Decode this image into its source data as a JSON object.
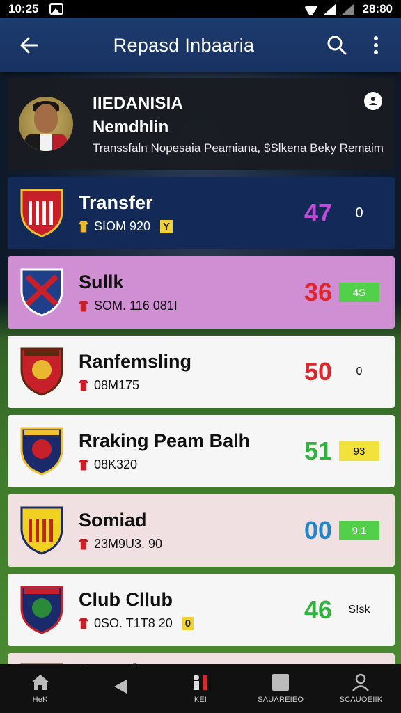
{
  "status_bar": {
    "time": "10:25",
    "clock_right": "28:80"
  },
  "app_bar": {
    "title": "Repasd Inbaaria"
  },
  "profile": {
    "name_line1": "IIEDANISIA",
    "name_line2": "Nemdhlin",
    "description": "Transsfaln Nopesaia Peamiana, $Slkena Beky Remaim"
  },
  "rows": [
    {
      "club": "Transfer",
      "sub": "SIOM 920",
      "tag": "Y",
      "score": "47",
      "score_color": "#c04ad8",
      "chip": "0",
      "chip_style": "plain-light",
      "style": "transfer",
      "crest": "red-white"
    },
    {
      "club": "Sullk",
      "sub": "SOM. 116 081I",
      "tag": "",
      "score": "36",
      "score_color": "#e0242a",
      "chip": "4S",
      "chip_style": "green",
      "style": "pink",
      "crest": "blue-x"
    },
    {
      "club": "Ranfemsling",
      "sub": "08M175",
      "tag": "",
      "score": "50",
      "score_color": "#e0242a",
      "chip": "0",
      "chip_style": "plain",
      "style": "white",
      "crest": "red-gold"
    },
    {
      "club": "Rraking Peam Balh",
      "sub": "08K320",
      "tag": "",
      "score": "51",
      "score_color": "#2fb33a",
      "chip": "93",
      "chip_style": "yellow",
      "style": "white",
      "crest": "navy-red"
    },
    {
      "club": "Somiad",
      "sub": "23M9U3. 90",
      "tag": "",
      "score": "00",
      "score_color": "#1e86c8",
      "chip": "9.1",
      "chip_style": "green",
      "style": "blush",
      "crest": "yellow-stripe"
    },
    {
      "club": "Club Cllub",
      "sub": "0SO. T1T8 20",
      "tag": "0",
      "score": "46",
      "score_color": "#2fb33a",
      "chip": "S!sk",
      "chip_style": "plain",
      "style": "white",
      "crest": "navy-green"
    },
    {
      "club": "Roned",
      "sub": "",
      "tag": "",
      "score": "",
      "score_color": "#e0242a",
      "chip": "",
      "chip_style": "plain",
      "style": "blush last",
      "crest": "red-gold"
    }
  ],
  "bottom_nav": [
    {
      "label": "HeK",
      "icon": "home-icon"
    },
    {
      "label": "",
      "icon": "back-triangle-icon"
    },
    {
      "label": "KEI",
      "icon": "players-icon"
    },
    {
      "label": "SAUAREIEO",
      "icon": "square-icon"
    },
    {
      "label": "SCAUOEIIK",
      "icon": "profile-icon"
    }
  ]
}
